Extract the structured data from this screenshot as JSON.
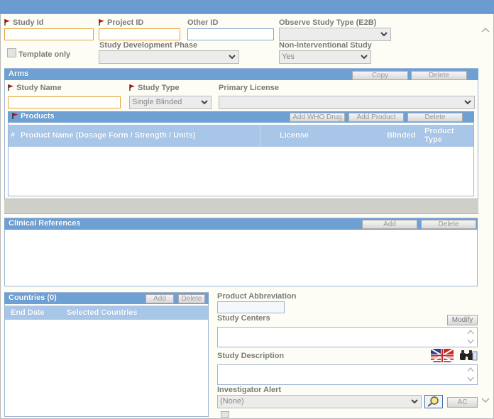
{
  "header": {
    "study_id_label": "Study Id",
    "project_id_label": "Project ID",
    "other_id_label": "Other ID",
    "observe_type_label": "Observe Study Type (E2B)",
    "observe_type_value": "",
    "template_only_label": "Template only",
    "phase_label": "Study Development Phase",
    "phase_value": "",
    "non_interventional_label": "Non-Interventional Study",
    "non_interventional_value": "Yes"
  },
  "arms": {
    "title": "Arms",
    "copy_label": "Copy",
    "delete_label": "Delete",
    "study_name_label": "Study Name",
    "study_type_label": "Study Type",
    "study_type_value": "Single Blinded",
    "primary_license_label": "Primary License",
    "primary_license_value": ""
  },
  "products": {
    "title": "Products",
    "add_who_drug_label": "Add WHO Drug",
    "add_product_label": "Add Product",
    "delete_label": "Delete",
    "columns": {
      "number": "#",
      "product_name": "Product Name (Dosage Form / Strength / Units)",
      "license": "License",
      "blinded": "Blinded",
      "product_type_line1": "Product",
      "product_type_line2": "Type"
    }
  },
  "clinical_references": {
    "title": "Clinical References",
    "add_label": "Add",
    "delete_label": "Delete"
  },
  "countries": {
    "title": "Countries (0)",
    "add_label": "Add",
    "delete_label": "Delete",
    "columns": {
      "end_date": "End Date",
      "selected_countries": "Selected Countries"
    }
  },
  "details": {
    "product_abbreviation_label": "Product Abbreviation",
    "study_centers_label": "Study Centers",
    "modify_label": "Modify",
    "study_description_label": "Study Description",
    "investigator_alert_label": "Investigator Alert",
    "investigator_alert_value": "(None)",
    "ac_label": "AC"
  },
  "colors": {
    "topbar": "#6b9bd1",
    "panel_header": "#6fa0d4",
    "grid_header": "#a8c6e8",
    "required_border": "#e8a13c",
    "background": "#fdfdf5"
  }
}
